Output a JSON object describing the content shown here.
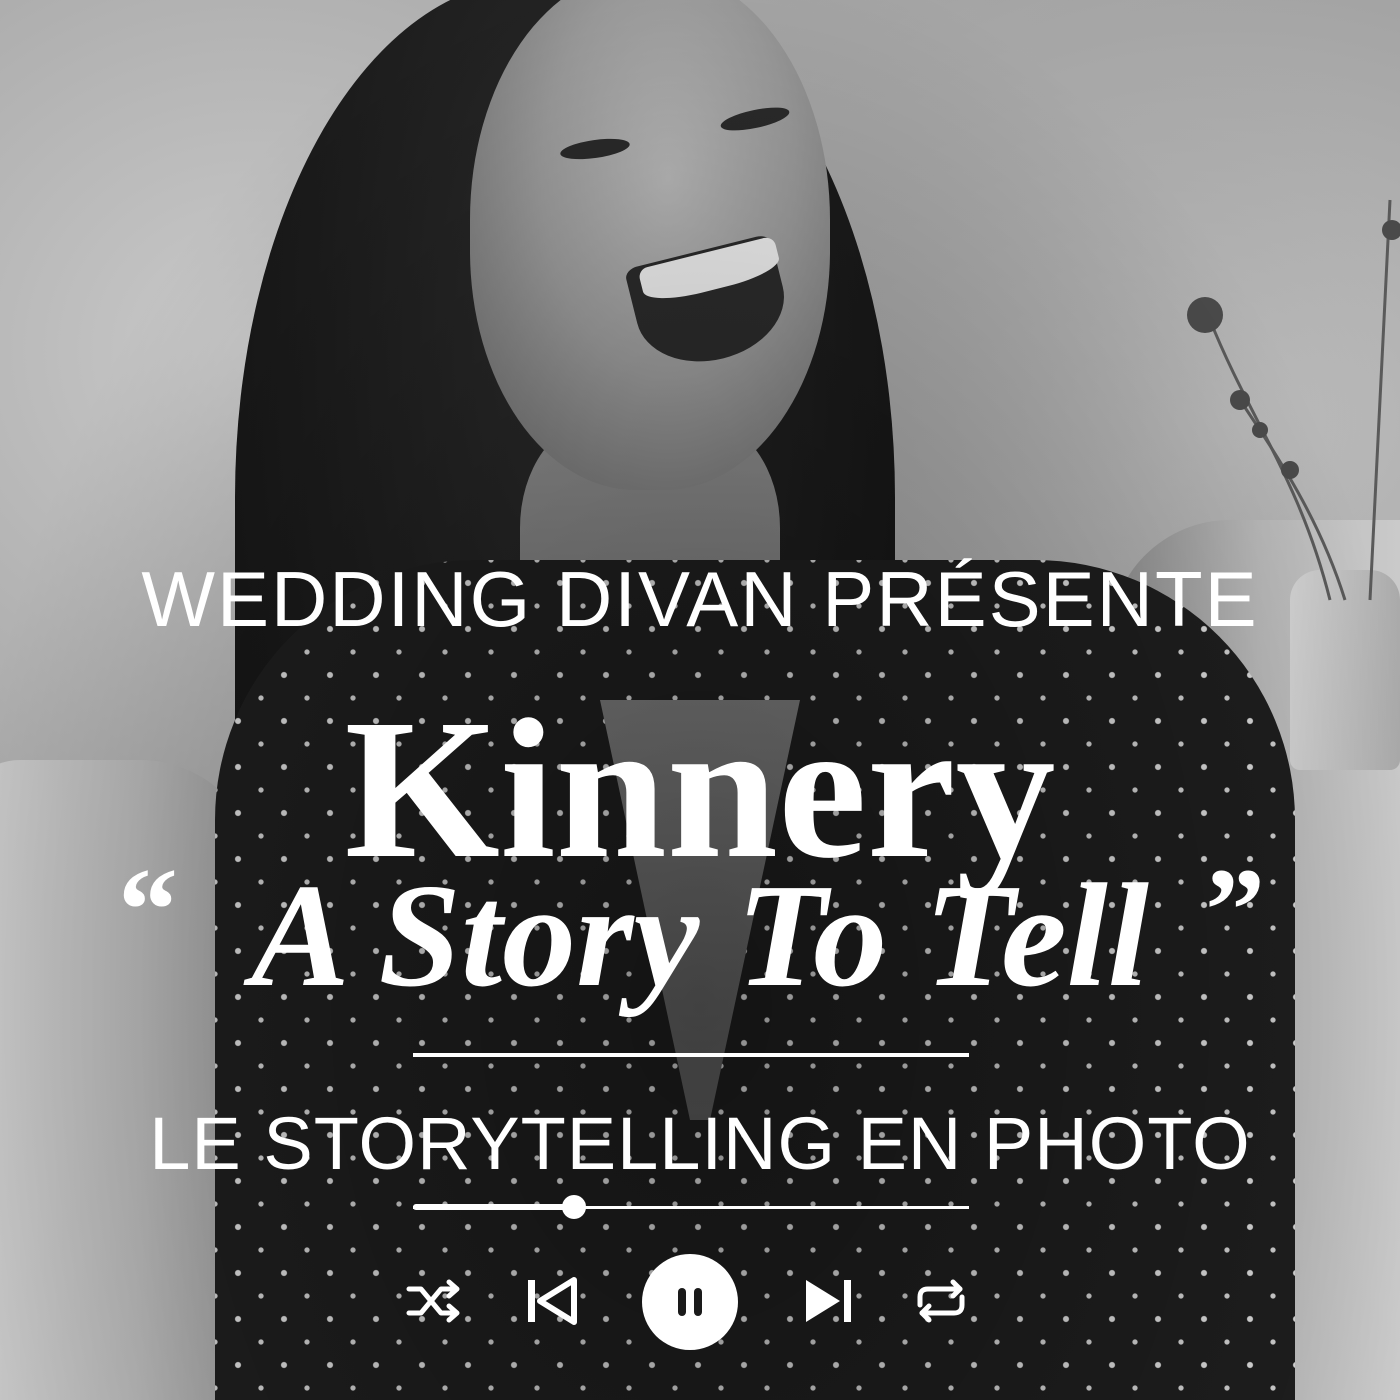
{
  "cover": {
    "presenter": "WEDDING DIVAN PRÉSENTE",
    "name": "Kinnery",
    "open_quote": "“",
    "subtitle": "A Story To Tell",
    "close_quote": "”",
    "tagline": "LE STORYTELLING EN PHOTO"
  },
  "player": {
    "progress_fraction": 0.29,
    "state": "playing",
    "controls": [
      "shuffle-icon",
      "previous-icon",
      "pause-icon",
      "next-icon",
      "repeat-icon"
    ]
  },
  "colors": {
    "text": "#ffffff",
    "controls": "#ffffff",
    "pause_glyph": "#1a1a1a"
  }
}
